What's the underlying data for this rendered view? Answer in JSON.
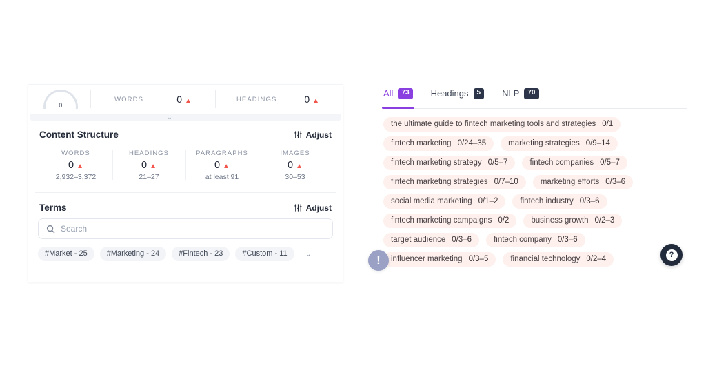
{
  "left_panel": {
    "summary": {
      "gauge": {
        "value": "0",
        "name": "content-score-gauge"
      },
      "metrics": [
        {
          "label": "WORDS",
          "value": "0",
          "trend": "▲"
        },
        {
          "label": "HEADINGS",
          "value": "0",
          "trend": "▲"
        }
      ]
    },
    "content_structure": {
      "title": "Content Structure",
      "adjust_label": "Adjust",
      "metrics": [
        {
          "label": "WORDS",
          "value": "0",
          "trend": "▲",
          "range": "2,932–3,372"
        },
        {
          "label": "HEADINGS",
          "value": "0",
          "trend": "▲",
          "range": "21–27"
        },
        {
          "label": "PARAGRAPHS",
          "value": "0",
          "trend": "▲",
          "range": "at least 91"
        },
        {
          "label": "IMAGES",
          "value": "0",
          "trend": "▲",
          "range": "30–53"
        }
      ]
    },
    "terms": {
      "title": "Terms",
      "adjust_label": "Adjust",
      "search_placeholder": "Search",
      "search_value": "",
      "tags": [
        "#Market - 25",
        "#Marketing - 24",
        "#Fintech - 23",
        "#Custom - 11"
      ],
      "expand_chevron": "⌄"
    }
  },
  "right_panel": {
    "tabs": [
      {
        "label": "All",
        "badge": "73",
        "active": true
      },
      {
        "label": "Headings",
        "badge": "5",
        "active": false
      },
      {
        "label": "NLP",
        "badge": "70",
        "active": false
      }
    ],
    "chips": [
      {
        "term": "the ultimate guide to fintech marketing tools and strategies",
        "count": "0/1"
      },
      {
        "term": "fintech marketing",
        "count": "0/24–35"
      },
      {
        "term": "marketing strategies",
        "count": "0/9–14"
      },
      {
        "term": "fintech marketing strategy",
        "count": "0/5–7"
      },
      {
        "term": "fintech companies",
        "count": "0/5–7"
      },
      {
        "term": "fintech marketing strategies",
        "count": "0/7–10"
      },
      {
        "term": "marketing efforts",
        "count": "0/3–6"
      },
      {
        "term": "social media marketing",
        "count": "0/1–2"
      },
      {
        "term": "fintech industry",
        "count": "0/3–6"
      },
      {
        "term": "fintech marketing campaigns",
        "count": "0/2"
      },
      {
        "term": "business growth",
        "count": "0/2–3"
      },
      {
        "term": "target audience",
        "count": "0/3–6"
      },
      {
        "term": "fintech company",
        "count": "0/3–6"
      },
      {
        "term": "influencer marketing",
        "count": "0/3–5"
      },
      {
        "term": "financial technology",
        "count": "0/2–4"
      }
    ]
  },
  "floating": {
    "alert_icon": "!",
    "help_label": "?"
  },
  "colors": {
    "accent_purple": "#8a3fe0",
    "trend_red": "#f2564d",
    "chip_bg": "#fdf0ed",
    "badge_dark": "#2c3549",
    "tag_bg": "#f2f4f8"
  }
}
